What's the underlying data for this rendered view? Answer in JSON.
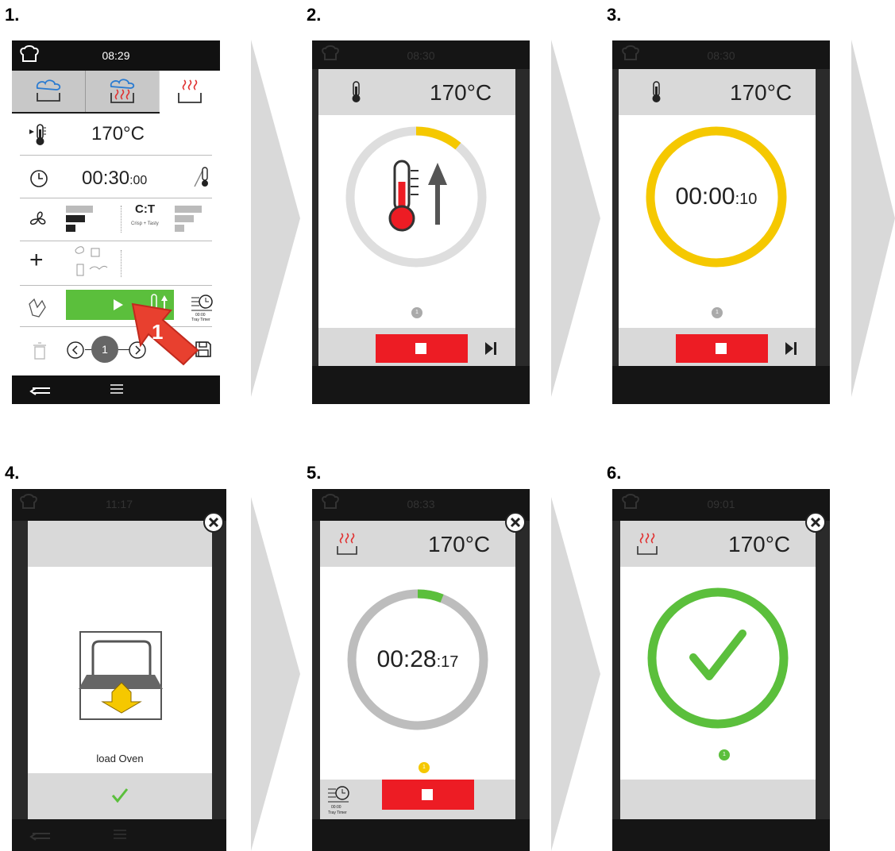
{
  "steps": [
    "1.",
    "2.",
    "3.",
    "4.",
    "5.",
    "6."
  ],
  "screen1": {
    "time": "08:29",
    "temperature": "170°C",
    "timer_main": "00:30",
    "timer_sec": ":00",
    "ct_logo": "C:T",
    "ct_caption": "Crisp + Tasty",
    "tray_timer_small": "00:00",
    "tray_timer_label": "Tray Timer",
    "step_number": "1",
    "arrow_label": "1"
  },
  "screen2": {
    "time": "08:30",
    "temperature": "170°C",
    "step_dot": "1",
    "progress": 0.11
  },
  "screen3": {
    "time": "08:30",
    "temperature": "170°C",
    "timer_main": "00:00",
    "timer_sec": ":10",
    "step_dot": "1"
  },
  "screen4": {
    "time": "11:17",
    "message": "load Oven"
  },
  "screen5": {
    "time": "08:33",
    "temperature": "170°C",
    "timer_main": "00:28",
    "timer_sec": ":17",
    "step_dot": "1",
    "tray_timer_small": "00:00",
    "tray_timer_label": "Tray Timer",
    "progress": 0.06
  },
  "screen6": {
    "time": "09:01",
    "temperature": "170°C",
    "step_dot": "1"
  },
  "colors": {
    "green": "#5bbf3c",
    "red": "#ed1c24",
    "yellow": "#f5c800",
    "gray_ring": "#bdbdbd",
    "light_ring": "#dedede"
  }
}
